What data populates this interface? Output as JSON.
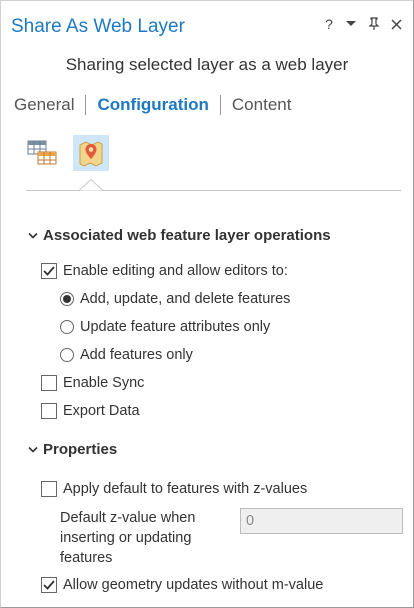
{
  "window": {
    "title": "Share As Web Layer",
    "controls": {
      "help": "?"
    }
  },
  "subtitle": "Sharing selected layer as a web layer",
  "tabs": [
    {
      "label": "General",
      "active": false
    },
    {
      "label": "Configuration",
      "active": true
    },
    {
      "label": "Content",
      "active": false
    }
  ],
  "config_icons": [
    {
      "icon": "table-grid-icon",
      "selected": false
    },
    {
      "icon": "feature-layer-icon",
      "selected": true
    }
  ],
  "operations": {
    "header": "Associated web feature layer operations",
    "enable_editing": {
      "label": "Enable editing and allow editors to:",
      "checked": true
    },
    "options": [
      {
        "label": "Add, update, and delete features",
        "selected": true
      },
      {
        "label": "Update feature attributes only",
        "selected": false
      },
      {
        "label": "Add features only",
        "selected": false
      }
    ],
    "enable_sync": {
      "label": "Enable Sync",
      "checked": false
    },
    "export_data": {
      "label": "Export Data",
      "checked": false
    }
  },
  "properties": {
    "header": "Properties",
    "apply_default_z": {
      "label": "Apply default to features with z-values",
      "checked": false
    },
    "default_z": {
      "label_lines": [
        "Default z-value when",
        "inserting or updating",
        "features"
      ],
      "value": "0"
    },
    "allow_geometry_updates": {
      "label": "Allow geometry updates without m-value",
      "checked": true
    }
  },
  "colors": {
    "accent": "#1e78c3",
    "selected_bg": "#cfe5f8"
  }
}
